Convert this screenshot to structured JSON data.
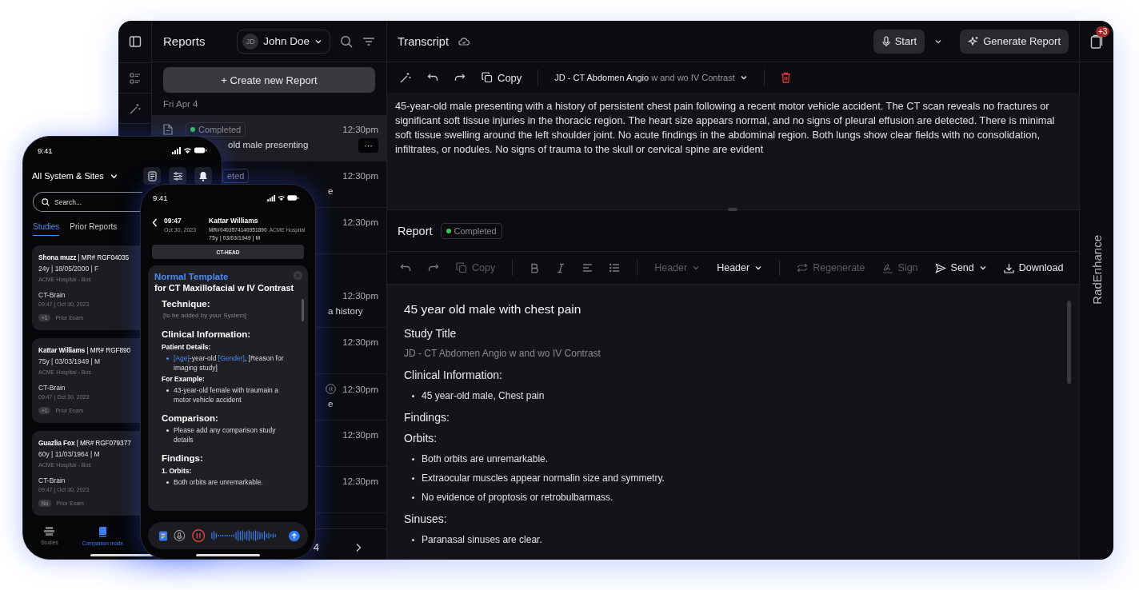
{
  "list": {
    "title": "Reports",
    "user": {
      "initials": "JD",
      "name": "John Doe"
    },
    "create_button": "+ Create new Report",
    "groups": [
      {
        "date": "Fri Apr 4",
        "rows": [
          {
            "selected": true,
            "file_icon": true,
            "badge": {
              "text": "Completed",
              "dot": true
            },
            "text": "old male presenting",
            "time": "12:30pm",
            "more": "···",
            "recording": false
          },
          {
            "selected": false,
            "badge": {
              "text": "eted",
              "dot": false
            },
            "text": "e",
            "time": "12:30pm",
            "recording": false
          },
          {
            "selected": false,
            "time": "12:30pm",
            "recording": false
          }
        ]
      },
      {
        "rows": [
          {
            "selected": false,
            "text": "a history",
            "time": "12:30pm",
            "recording": false
          },
          {
            "selected": false,
            "time": "12:30pm",
            "recording": false
          },
          {
            "selected": false,
            "text": "e",
            "time": "12:30pm",
            "recording": true
          },
          {
            "selected": false,
            "time": "12:30pm",
            "recording": false
          },
          {
            "selected": false,
            "time": "12:30pm",
            "recording": false
          }
        ]
      }
    ],
    "footer": {
      "page": "4"
    }
  },
  "transcript": {
    "title": "Transcript",
    "start_button": "Start",
    "generate_button": "Generate Report",
    "notifications": "+3",
    "copy": "Copy",
    "template": {
      "primary": "JD - CT Abdomen Angio",
      "secondary": "w and wo IV Contrast"
    },
    "text": "45-year-old male presenting with a history of persistent chest pain following a recent motor vehicle accident. The CT scan reveals no fractures or significant soft tissue injuries in the thoracic region. The heart size appears normal, and no signs of pleural effusion are detected. There is minimal soft tissue swelling around the left shoulder joint. No acute findings in the abdominal region. Both lungs show clear fields with no consolidation, infiltrates, or nodules. No signs of trauma to the skull or cervical spine are evident"
  },
  "report": {
    "title": "Report",
    "status": "Completed",
    "toolbar": {
      "copy": {
        "label": "Copy",
        "disabled": true
      },
      "style_menu": {
        "label": "Header",
        "disabled": true
      },
      "heading_menu": {
        "label": "Header",
        "disabled": false
      },
      "regenerate": {
        "label": "Regenerate",
        "disabled": true
      },
      "sign": {
        "label": "Sign",
        "disabled": true
      },
      "send": {
        "label": "Send",
        "disabled": false
      },
      "download": {
        "label": "Download",
        "disabled": false
      }
    },
    "blocks": [
      {
        "kind": "title",
        "text": "45 year old male with chest pain"
      },
      {
        "kind": "heading",
        "text": "Study Title"
      },
      {
        "kind": "muted",
        "text": "JD - CT Abdomen Angio w and wo IV Contrast"
      },
      {
        "kind": "heading",
        "text": "Clinical Information:"
      },
      {
        "kind": "bullet",
        "text": "45 year-old male, Chest pain"
      },
      {
        "kind": "heading",
        "text": "Findings:"
      },
      {
        "kind": "heading",
        "text": "Orbits:"
      },
      {
        "kind": "bullet",
        "text": "Both orbits are unremarkable."
      },
      {
        "kind": "bullet",
        "text": "Extraocular muscles appear normalin size and symmetry."
      },
      {
        "kind": "bullet",
        "text": "No evidence of proptosis or retrobulbarmass."
      },
      {
        "kind": "heading",
        "text": "Sinuses:"
      },
      {
        "kind": "bullet",
        "text": "Paranasal sinuses are clear."
      }
    ]
  },
  "brand": "RadEnhance",
  "phone_list": {
    "time": "9:41",
    "scope": "All System & Sites",
    "search_placeholder": "Search...",
    "tabs": [
      {
        "label": "Studies",
        "selected": true
      },
      {
        "label": "Prior Reports",
        "selected": false
      }
    ],
    "cards": [
      {
        "name": "**Shona muzz** | MR# RGF04035",
        "details": "24y | 18/05/2000 | F",
        "site": "ACME Hospital - Bos",
        "study": "CT-Brain",
        "date": "09:47 | Oct 30, 2023",
        "count": "+1",
        "prior": "Prior Exam"
      },
      {
        "name": "**Kattar Williams** | MR# RGF890",
        "details": "75y | 03/03/1949 | M",
        "site": "ACME Hospital - Bos",
        "study": "CT-Brain",
        "date": "09:47 | Oct 30, 2023",
        "count": "+1",
        "prior": "Prior Exam"
      },
      {
        "name": "**Guazlia Fox** | MR# RGF079377",
        "details": "60y | 11/03/1964 | M",
        "site": "ACME Hospital - Bos",
        "study": "CT-Brain",
        "date": "09:47 | Oct 30, 2023",
        "count": "No",
        "prior": "Prior Exam"
      }
    ],
    "nav": [
      {
        "label": "Studies",
        "selected": false
      },
      {
        "label": "Companion mode",
        "selected": true
      }
    ]
  },
  "phone_report": {
    "time": "9:41",
    "study_time": "09:47",
    "study_date": "Oct 30, 2023",
    "patient": "Kattar Williams",
    "mrn": "MR#0403574140951890",
    "site": "ACME Hospital",
    "details": "75y | 03/03/1949 | M",
    "study": "CT-HEAD",
    "template_title": "Normal Template",
    "template_subtitle": "for CT Maxillofacial w IV Contrast",
    "blocks": [
      {
        "kind": "heading",
        "text": "Technique:"
      },
      {
        "kind": "hint",
        "text": "[to be added by your System]"
      },
      {
        "kind": "heading",
        "text": "Clinical Information:"
      },
      {
        "kind": "label",
        "text": "Patient Details:"
      },
      {
        "kind": "bullet",
        "highlighted": true,
        "parts": [
          {
            "text": "[Age]",
            "placeholder": true
          },
          {
            "text": "-year-old ",
            "placeholder": false
          },
          {
            "text": "[Gender]",
            "placeholder": true
          },
          {
            "text": ", [Reason for imaging study]",
            "placeholder": false
          }
        ]
      },
      {
        "kind": "label",
        "text": "For Example:"
      },
      {
        "kind": "bullet",
        "highlighted": false,
        "parts": [
          {
            "text": "43-year-old female with traumain a motor vehicle accident",
            "placeholder": false
          }
        ]
      },
      {
        "kind": "heading",
        "text": "Comparison:"
      },
      {
        "kind": "bullet",
        "highlighted": false,
        "parts": [
          {
            "text": "Please add any comparison study details",
            "placeholder": false
          }
        ]
      },
      {
        "kind": "heading",
        "text": "Findings:"
      },
      {
        "kind": "label",
        "text": "1. Orbits:"
      },
      {
        "kind": "bullet",
        "highlighted": false,
        "parts": [
          {
            "text": "Both orbits are unremarkable.",
            "placeholder": false
          }
        ]
      }
    ]
  }
}
